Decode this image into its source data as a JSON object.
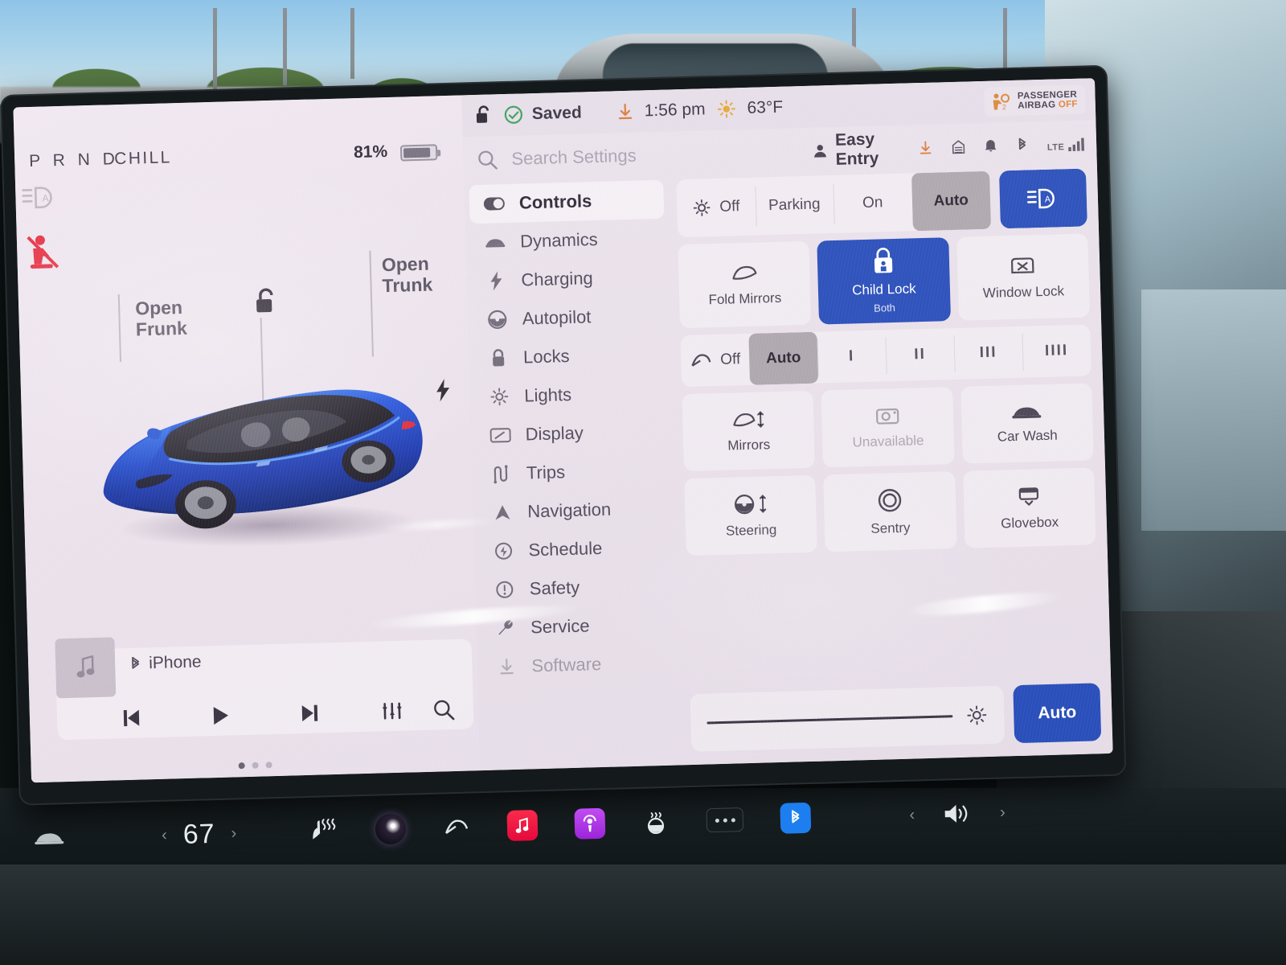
{
  "drive_status": {
    "gear_sequence": "P R N D",
    "selected_gear": "D",
    "drive_mode": "CHILL",
    "battery_percent": "81%",
    "icons": [
      "auto-highbeam-icon",
      "seatbelt-warning-icon"
    ]
  },
  "car_view": {
    "frunk_label_line1": "Open",
    "frunk_label_line2": "Frunk",
    "trunk_label_line1": "Open",
    "trunk_label_line2": "Trunk",
    "lock_state": "unlocked",
    "vehicle_color": "#1248d8",
    "roof_color": "#15151a"
  },
  "media": {
    "source": "iPhone",
    "source_icon": "bluetooth-icon",
    "album_art_icon": "music-note-icon",
    "controls": [
      "previous-track-button",
      "play-button",
      "next-track-button",
      "equalizer-button",
      "search-button"
    ],
    "page_dots": 3,
    "active_dot": 1
  },
  "settings": {
    "statusbar": {
      "lock_icon": "unlocked-padlock-icon",
      "saved_label": "Saved",
      "saved_icon": "check-circle-icon",
      "download_icon": "download-icon",
      "time": "1:56 pm",
      "weather_icon": "sun-icon",
      "temperature": "63°F",
      "airbag_line1": "PASSENGER",
      "airbag_line2": "AIRBAG",
      "airbag_state": "OFF",
      "airbag_state_color": "#e07a22"
    },
    "search": {
      "placeholder": "Search Settings",
      "icon": "search-icon"
    },
    "profile": {
      "name": "Easy Entry",
      "icon": "person-icon"
    },
    "tray_icons": [
      "download-icon",
      "garage-door-icon",
      "bell-icon",
      "bluetooth-icon"
    ],
    "network": {
      "type": "LTE",
      "signal_bars": 4
    },
    "menu": [
      {
        "label": "Controls",
        "icon": "toggle-icon",
        "active": true
      },
      {
        "label": "Dynamics",
        "icon": "car-icon",
        "active": false
      },
      {
        "label": "Charging",
        "icon": "bolt-icon",
        "active": false
      },
      {
        "label": "Autopilot",
        "icon": "steering-wheel-icon",
        "active": false
      },
      {
        "label": "Locks",
        "icon": "lock-icon",
        "active": false
      },
      {
        "label": "Lights",
        "icon": "sun-icon",
        "active": false
      },
      {
        "label": "Display",
        "icon": "display-icon",
        "active": false
      },
      {
        "label": "Trips",
        "icon": "route-icon",
        "active": false
      },
      {
        "label": "Navigation",
        "icon": "navigation-arrow-icon",
        "active": false
      },
      {
        "label": "Schedule",
        "icon": "schedule-clock-icon",
        "active": false
      },
      {
        "label": "Safety",
        "icon": "alert-circle-icon",
        "active": false
      },
      {
        "label": "Service",
        "icon": "wrench-icon",
        "active": false
      },
      {
        "label": "Software",
        "icon": "download-icon",
        "active": false
      }
    ],
    "headlights": {
      "icon": "sun-icon",
      "options": [
        "Off",
        "Parking",
        "On",
        "Auto"
      ],
      "selected": "Auto",
      "highbeam_button_icon": "auto-highbeam-icon",
      "highbeam_active": true
    },
    "lock_tiles": [
      {
        "label": "Fold Mirrors",
        "icon": "mirror-icon",
        "state": "off"
      },
      {
        "label": "Child Lock",
        "sub": "Both",
        "icon": "child-lock-icon",
        "state": "on"
      },
      {
        "label": "Window Lock",
        "label2": "Lock",
        "icon": "window-lock-icon",
        "state": "off"
      }
    ],
    "wipers": {
      "icon": "wiper-icon",
      "options": [
        "Off",
        "Auto",
        "I",
        "II",
        "III",
        "IIII"
      ],
      "selected": "Auto"
    },
    "quick_tiles_row1": [
      {
        "label": "Mirrors",
        "icon": "mirror-adjust-icon",
        "enabled": true
      },
      {
        "label": "Unavailable",
        "icon": "camera-icon",
        "enabled": false
      },
      {
        "label": "Car Wash",
        "icon": "car-icon",
        "enabled": true
      }
    ],
    "quick_tiles_row2": [
      {
        "label": "Steering",
        "icon": "steering-adjust-icon",
        "enabled": true
      },
      {
        "label": "Sentry",
        "icon": "sentry-icon",
        "enabled": true
      },
      {
        "label": "Glovebox",
        "icon": "glovebox-icon",
        "enabled": true
      }
    ],
    "brightness": {
      "icon": "brightness-icon",
      "value_percent": 96,
      "auto_label": "Auto",
      "auto_active": true
    },
    "accent_color": "#1b45b5",
    "selected_segment_color": "#a9a2a7"
  },
  "dock": {
    "car_icon": "car-icon",
    "temp_left": "67",
    "prev_chevron": "‹",
    "next_chevron": "›",
    "seat_heater_icon": "seat-heater-icon",
    "wiper_icon": "wiper-icon",
    "apps": [
      {
        "name": "music-app-icon",
        "color": "#e4093c"
      },
      {
        "name": "podcasts-app-icon",
        "color": "#9b24d9"
      }
    ],
    "steering_heat_icon": "steering-heat-icon",
    "more_button": "more-dots-button",
    "bluetooth_icon": "bluetooth-icon",
    "volume_icon": "volume-icon"
  }
}
